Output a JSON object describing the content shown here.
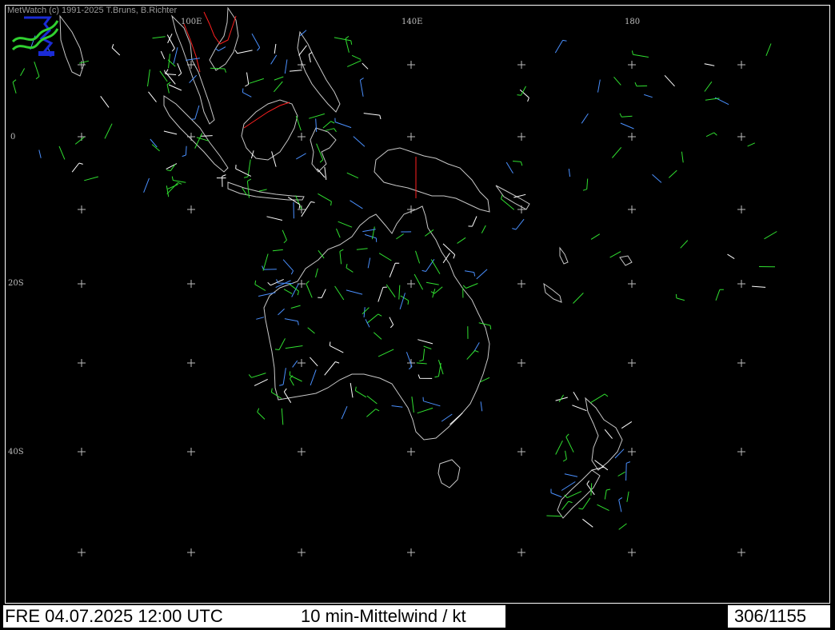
{
  "copyright": "MetWatch  (c) 1991-2025 T.Bruns, B.Richter",
  "lon_labels": [
    "100E",
    "140E",
    "180"
  ],
  "lat_labels": [
    "0",
    "20S",
    "40S"
  ],
  "footer": {
    "date_time": "FRE 04.07.2025 12:00 UTC",
    "parameter": "10 min-Mittelwind / kt",
    "count": "306/1155"
  },
  "colors": {
    "background": "#000000",
    "coastline": "#c8c8c8",
    "border": "#ff2020",
    "wind_green": "#30e030",
    "wind_blue": "#4a90ff",
    "wind_white": "#ffffff",
    "wind_yellow": "#f0f060",
    "wind_orange": "#ff9020",
    "grid_cross": "#bdbdbd"
  },
  "icons": [
    "metwatch-logo-icon"
  ]
}
